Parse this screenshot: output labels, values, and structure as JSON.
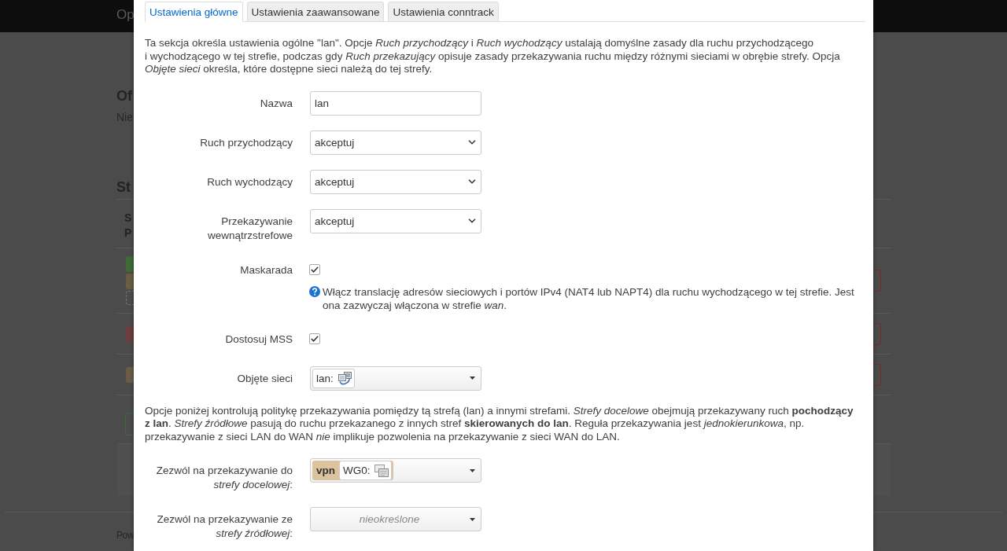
{
  "backdrop": {
    "header_title": "Op",
    "section_title": "Of",
    "section_text": "Nie",
    "table_title": "St",
    "table": {
      "header_lines": [
        "S",
        "P"
      ],
      "rows": [
        {
          "tags": [
            {
              "kind": "filled",
              "color": "#3f6a38"
            },
            {
              "kind": "filled",
              "color": "#6a5c45"
            },
            {
              "kind": "dashed",
              "color": "#747474"
            }
          ]
        },
        {
          "tags": [
            {
              "kind": "filled",
              "color": "#6e3c3c"
            }
          ]
        },
        {
          "tags": [
            {
              "kind": "filled",
              "color": "#6a5c45"
            }
          ]
        }
      ]
    },
    "footer_text": "Pow"
  },
  "dialog": {
    "tabs": [
      {
        "label": "Ustawienia główne",
        "selected": true
      },
      {
        "label": "Ustawienia zaawansowane",
        "selected": false
      },
      {
        "label": "Ustawienia conntrack",
        "selected": false
      }
    ],
    "intro": "Ta sekcja określa ustawienia ogólne \"lan\". Opcje *Ruch przychodzący* i *Ruch wychodzący* ustalają domyślne zasady dla ruchu przychodzącego\ni wychodzącego w tej strefie, podczas gdy *Ruch przekazujący* opisuje zasady przekazywania ruchu między różnymi sieciami w obrębie strefy. Opcja *Objęte sieci* określa, które dostępne sieci należą do tej strefy.",
    "items": [
      {
        "kind": "text",
        "label": "Nazwa",
        "value": "lan"
      },
      {
        "kind": "select",
        "label": "Ruch przychodzący",
        "value": "akceptuj"
      },
      {
        "kind": "select",
        "label": "Ruch wychodzący",
        "value": "akceptuj"
      },
      {
        "kind": "select",
        "label": "Przekazywanie wewnątrzstrefowe",
        "value": "akceptuj"
      },
      {
        "kind": "checkbox",
        "label": "Maskarada",
        "checked": true,
        "help": "Włącz translację adresów sieciowych i portów IPv4 (NAT4 lub NAPT4) dla ruchu wychodzącego w tej strefie. Jest ona zazwyczaj włączona w strefie *wan*."
      },
      {
        "kind": "checkbox",
        "label": "Dostosuj MSS",
        "checked": true
      },
      {
        "kind": "network_picker",
        "label": "Objęte sieci",
        "chips": [
          {
            "name": "lan:"
          }
        ]
      },
      {
        "kind": "paragraph",
        "text": "Opcje poniżej kontrolują politykę przekazywania pomiędzy tą strefą (lan) a innymi strefami. *Strefy docelowe* obejmują przekazywany ruch **pochodzący z lan**. *Strefy źródłowe* pasują do ruchu przekazanego z innych stref **skierowanych do lan**. Reguła przekazywania jest *jednokierunkowa*, np. przekazywanie z sieci LAN do WAN *nie* implikuje pozwolenia na przekazywanie z sieci WAN do LAN."
      },
      {
        "kind": "zone_picker",
        "label": "Zezwól na przekazywanie do *strefy docelowej*:",
        "zones": [
          {
            "name": "vpn",
            "color": "#dcc39e",
            "networks": [
              {
                "name": "WG0:"
              }
            ]
          }
        ]
      },
      {
        "kind": "zone_picker",
        "label": "Zezwól na przekazywanie ze *strefy źródłowej*:",
        "placeholder": "nieokreślone"
      }
    ]
  }
}
